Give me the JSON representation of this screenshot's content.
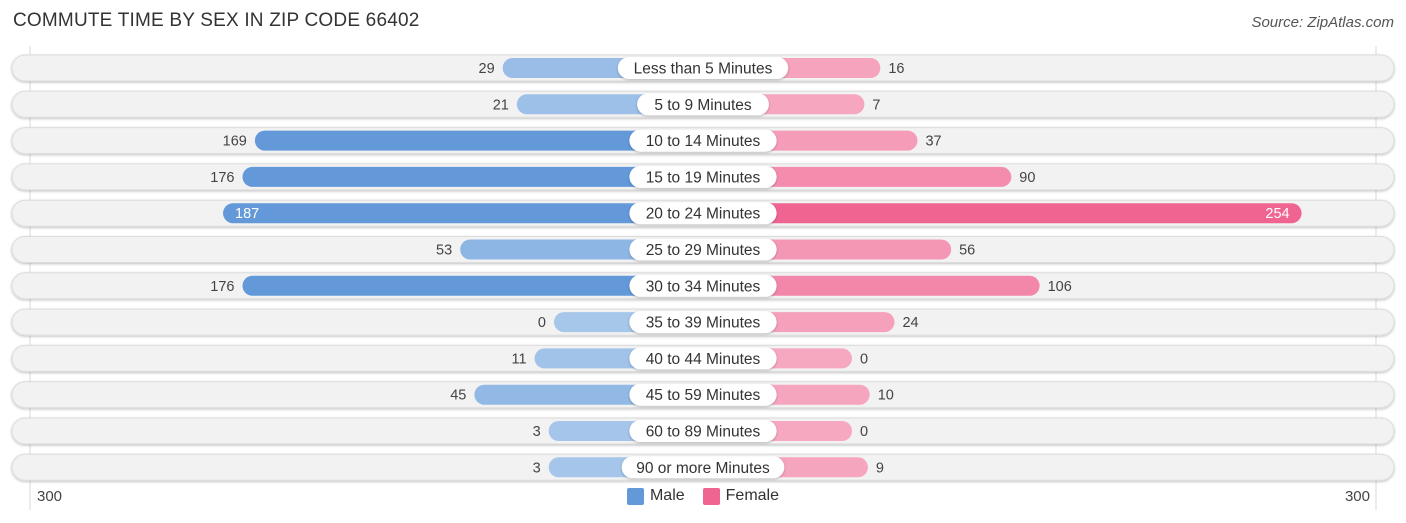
{
  "header": {
    "title": "COMMUTE TIME BY SEX IN ZIP CODE 66402",
    "source": "Source: ZipAtlas.com"
  },
  "colors": {
    "male_dark": "#6399d9",
    "male_light": "#a6c6ea",
    "female_dark": "#f06492",
    "female_light": "#f6a8c0",
    "track": "#f2f2f2",
    "label_bg": "#ffffff"
  },
  "axis": {
    "left_label": "300",
    "right_label": "300"
  },
  "legend": {
    "male": "Male",
    "female": "Female"
  },
  "chart_data": {
    "type": "bar",
    "orientation": "horizontal-diverging",
    "title": "COMMUTE TIME BY SEX IN ZIP CODE 66402",
    "xlabel": "",
    "ylabel": "",
    "xlim": [
      -300,
      300
    ],
    "legend_position": "bottom-center",
    "categories": [
      "Less than 5 Minutes",
      "5 to 9 Minutes",
      "10 to 14 Minutes",
      "15 to 19 Minutes",
      "20 to 24 Minutes",
      "25 to 29 Minutes",
      "30 to 34 Minutes",
      "35 to 39 Minutes",
      "40 to 44 Minutes",
      "45 to 59 Minutes",
      "60 to 89 Minutes",
      "90 or more Minutes"
    ],
    "series": [
      {
        "name": "Male",
        "values": [
          29,
          21,
          169,
          176,
          187,
          53,
          176,
          0,
          11,
          45,
          3,
          3
        ]
      },
      {
        "name": "Female",
        "values": [
          16,
          7,
          37,
          90,
          254,
          56,
          106,
          24,
          0,
          10,
          0,
          9
        ]
      }
    ]
  }
}
